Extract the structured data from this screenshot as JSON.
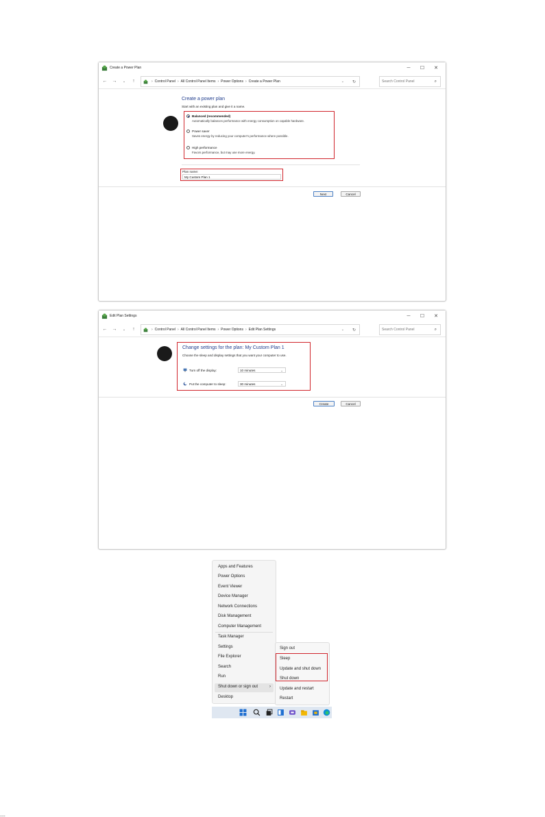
{
  "window1": {
    "title": "Create a Power Plan",
    "controls": {
      "minimize": "─",
      "maximize": "☐",
      "close": "✕"
    },
    "nav": {
      "back": "←",
      "forward": "→",
      "recent": "⌄",
      "up": "↑"
    },
    "breadcrumb": [
      "Control Panel",
      "All Control Panel Items",
      "Power Options",
      "Create a Power Plan"
    ],
    "breadcrumb_sep": "›",
    "search_placeholder": "Search Control Panel",
    "heading": "Create a power plan",
    "subheading": "Start with an existing plan and give it a name.",
    "options": [
      {
        "title": "Balanced (recommended)",
        "desc": "Automatically balances performance with energy consumption on capable hardware.",
        "selected": true
      },
      {
        "title": "Power saver",
        "desc": "Saves energy by reducing your computer's performance where possible.",
        "selected": false
      },
      {
        "title": "High performance",
        "desc": "Favors performance, but may use more energy.",
        "selected": false
      }
    ],
    "plan_name_label": "Plan name:",
    "plan_name_value": "My Custom Plan 1",
    "next_label": "Next",
    "cancel_label": "Cancel"
  },
  "window2": {
    "title": "Edit Plan Settings",
    "controls": {
      "minimize": "─",
      "maximize": "☐",
      "close": "✕"
    },
    "nav": {
      "back": "←",
      "forward": "→",
      "recent": "⌄",
      "up": "↑"
    },
    "breadcrumb": [
      "Control Panel",
      "All Control Panel Items",
      "Power Options",
      "Edit Plan Settings"
    ],
    "breadcrumb_sep": "›",
    "search_placeholder": "Search Control Panel",
    "heading": "Change settings for the plan: My Custom Plan 1",
    "subheading": "Choose the sleep and display settings that you want your computer to use.",
    "display_label": "Turn off the display:",
    "display_value": "10 minutes",
    "sleep_label": "Put the computer to sleep:",
    "sleep_value": "30 minutes",
    "create_label": "Create",
    "cancel_label": "Cancel"
  },
  "context_menu": {
    "items": [
      "Apps and Features",
      "Power Options",
      "Event Viewer",
      "Device Manager",
      "Network Connections",
      "Disk Management",
      "Computer Management",
      "Task Manager",
      "Settings",
      "File Explorer",
      "Search",
      "Run",
      "Shut down or sign out",
      "Desktop"
    ],
    "submenu_arrow": "›",
    "submenu": [
      "Sign out",
      "Sleep",
      "Update and shut down",
      "Shut down",
      "Update and restart",
      "Restart"
    ]
  },
  "colors": {
    "highlight_box": "#d0232a",
    "heading_blue": "#1e3b8c",
    "taskbar": "#dfe7f1"
  },
  "footer_text": "...."
}
